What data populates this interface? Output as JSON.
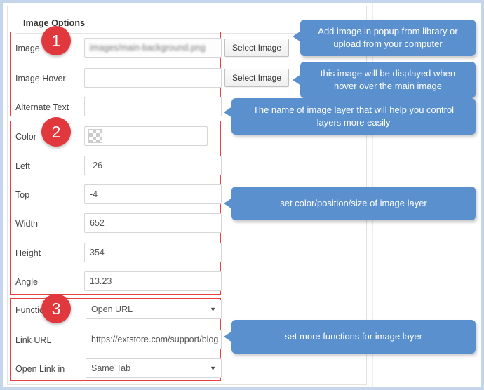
{
  "window": {
    "frame_color": "#c5d5ec",
    "background": "#ffffff"
  },
  "panel": {
    "title": "Image Options"
  },
  "badges": [
    {
      "label": "1"
    },
    {
      "label": "2"
    },
    {
      "label": "3"
    }
  ],
  "sections": {
    "image": {
      "fields": [
        {
          "label": "Image",
          "value": "images/main-background.png",
          "blurred": true,
          "button": "Select Image"
        },
        {
          "label": "Image Hover",
          "value": "",
          "blurred": false,
          "button": "Select Image"
        },
        {
          "label": "Alternate Text",
          "value": "",
          "blurred": false,
          "button": ""
        }
      ]
    },
    "style": {
      "color": {
        "label": "Color",
        "swatch": "transparent-checkerboard"
      },
      "fields": [
        {
          "label": "Left",
          "value": "-26"
        },
        {
          "label": "Top",
          "value": "-4"
        },
        {
          "label": "Width",
          "value": "652"
        },
        {
          "label": "Height",
          "value": "354"
        },
        {
          "label": "Angle",
          "value": "13.23"
        }
      ]
    },
    "functions": {
      "function": {
        "label": "Function",
        "value": "Open URL",
        "caret": "▼"
      },
      "link_url": {
        "label": "Link URL",
        "value": "https://extstore.com/support/blog"
      },
      "open_link_in": {
        "label": "Open Link in",
        "value": "Same Tab",
        "caret": "▼"
      }
    }
  },
  "callouts": [
    {
      "text": "Add image in popup from library or upload from your computer"
    },
    {
      "text": "this image will be displayed when hover over the main image"
    },
    {
      "text": "The name of image layer that will help you control layers more easily"
    },
    {
      "text": "set color/position/size of image layer"
    },
    {
      "text": "set more functions for image layer"
    }
  ],
  "colors": {
    "badge_red": "#e0383c",
    "group_border_red": "#e8413f",
    "callout_blue": "#5b90ce",
    "frame_blue": "#c5d5ec"
  }
}
